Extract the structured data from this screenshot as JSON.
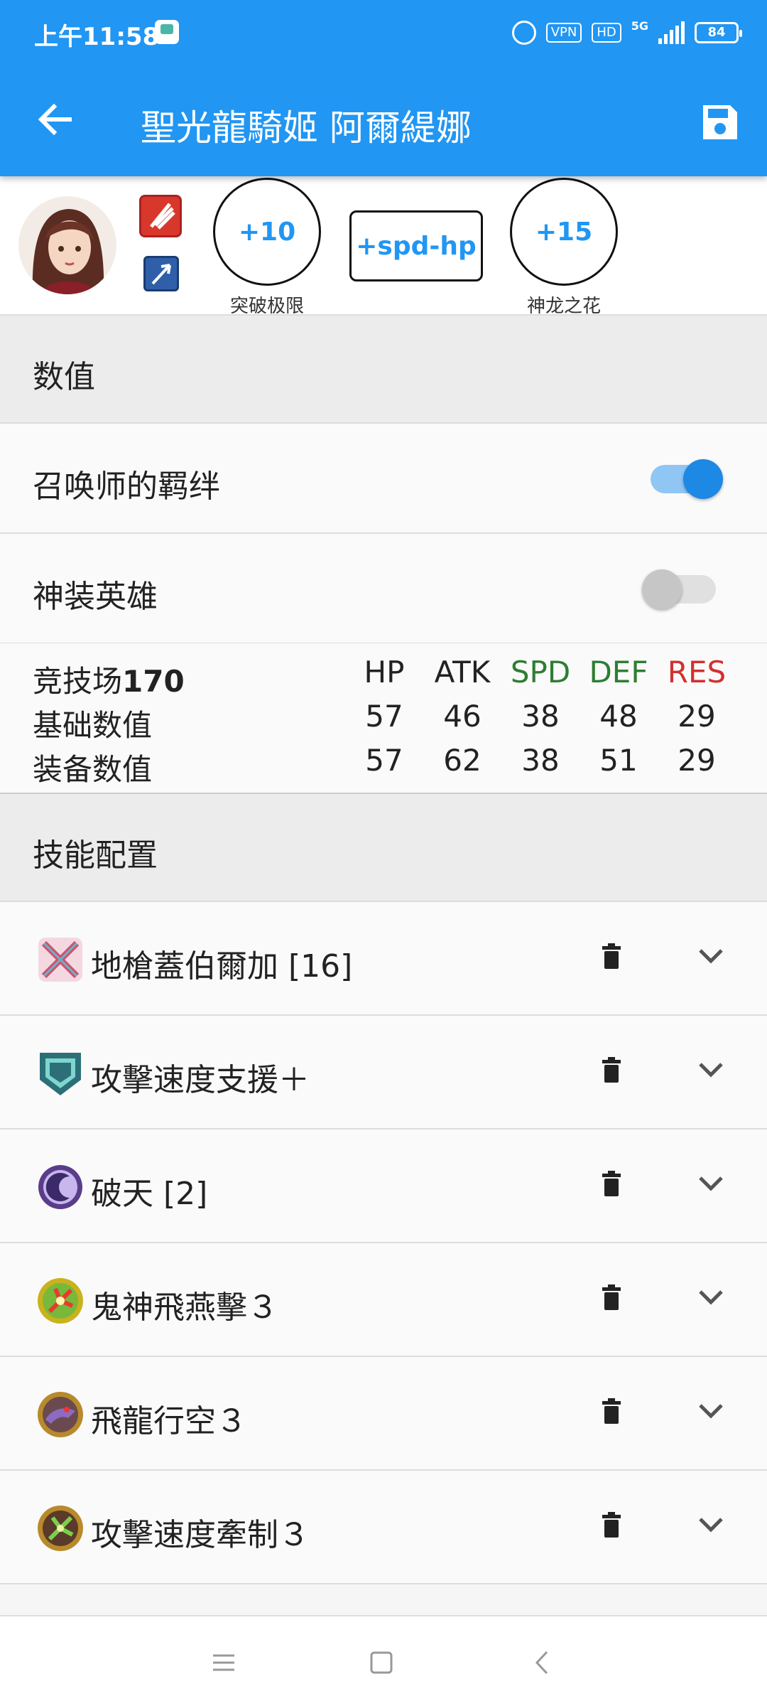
{
  "status_bar": {
    "time": "上午11:58",
    "vpn": "VPN",
    "hd": "HD",
    "network": "5G",
    "battery": "84"
  },
  "app_bar": {
    "title": "聖光龍騎姬  阿爾緹娜",
    "icons": {
      "back": "arrow-left-icon",
      "save": "save-icon"
    }
  },
  "hero": {
    "merge_value": "+10",
    "merge_caption": "突破极限",
    "boon_bane": "+spd-hp",
    "dragonflower_value": "+15",
    "dragonflower_caption": "神龙之花",
    "weapon_type_icon": "red-sword-icon",
    "move_type_icon": "flier-icon"
  },
  "sections": {
    "stats_title": "数值",
    "skills_title": "技能配置"
  },
  "toggles": {
    "summoner_support": {
      "label": "召唤师的羁绊",
      "on": true
    },
    "resplendent": {
      "label": "神装英雄",
      "on": false
    }
  },
  "stats": {
    "arena_label": "竞技场",
    "arena_score": "170",
    "headers": [
      "HP",
      "ATK",
      "SPD",
      "DEF",
      "RES"
    ],
    "header_colors": [
      "#222222",
      "#222222",
      "#2e7d32",
      "#2e7d32",
      "#d32f2f"
    ],
    "rows": [
      {
        "label": "基础数值",
        "values": [
          "57",
          "46",
          "38",
          "48",
          "29"
        ]
      },
      {
        "label": "装备数值",
        "values": [
          "57",
          "62",
          "38",
          "51",
          "29"
        ]
      }
    ]
  },
  "skills": [
    {
      "name": "地槍蓋伯爾加 [16]",
      "icon": "weapon-icon"
    },
    {
      "name": "攻擊速度支援＋",
      "icon": "assist-icon"
    },
    {
      "name": "破天 [2]",
      "icon": "special-icon"
    },
    {
      "name": "鬼神飛燕擊３",
      "icon": "passive-a-icon"
    },
    {
      "name": "飛龍行空３",
      "icon": "passive-b-icon"
    },
    {
      "name": "攻擊速度牽制３",
      "icon": "passive-c-icon"
    }
  ],
  "nav_bar": {
    "icons": [
      "menu-icon",
      "home-icon",
      "back-icon"
    ]
  }
}
